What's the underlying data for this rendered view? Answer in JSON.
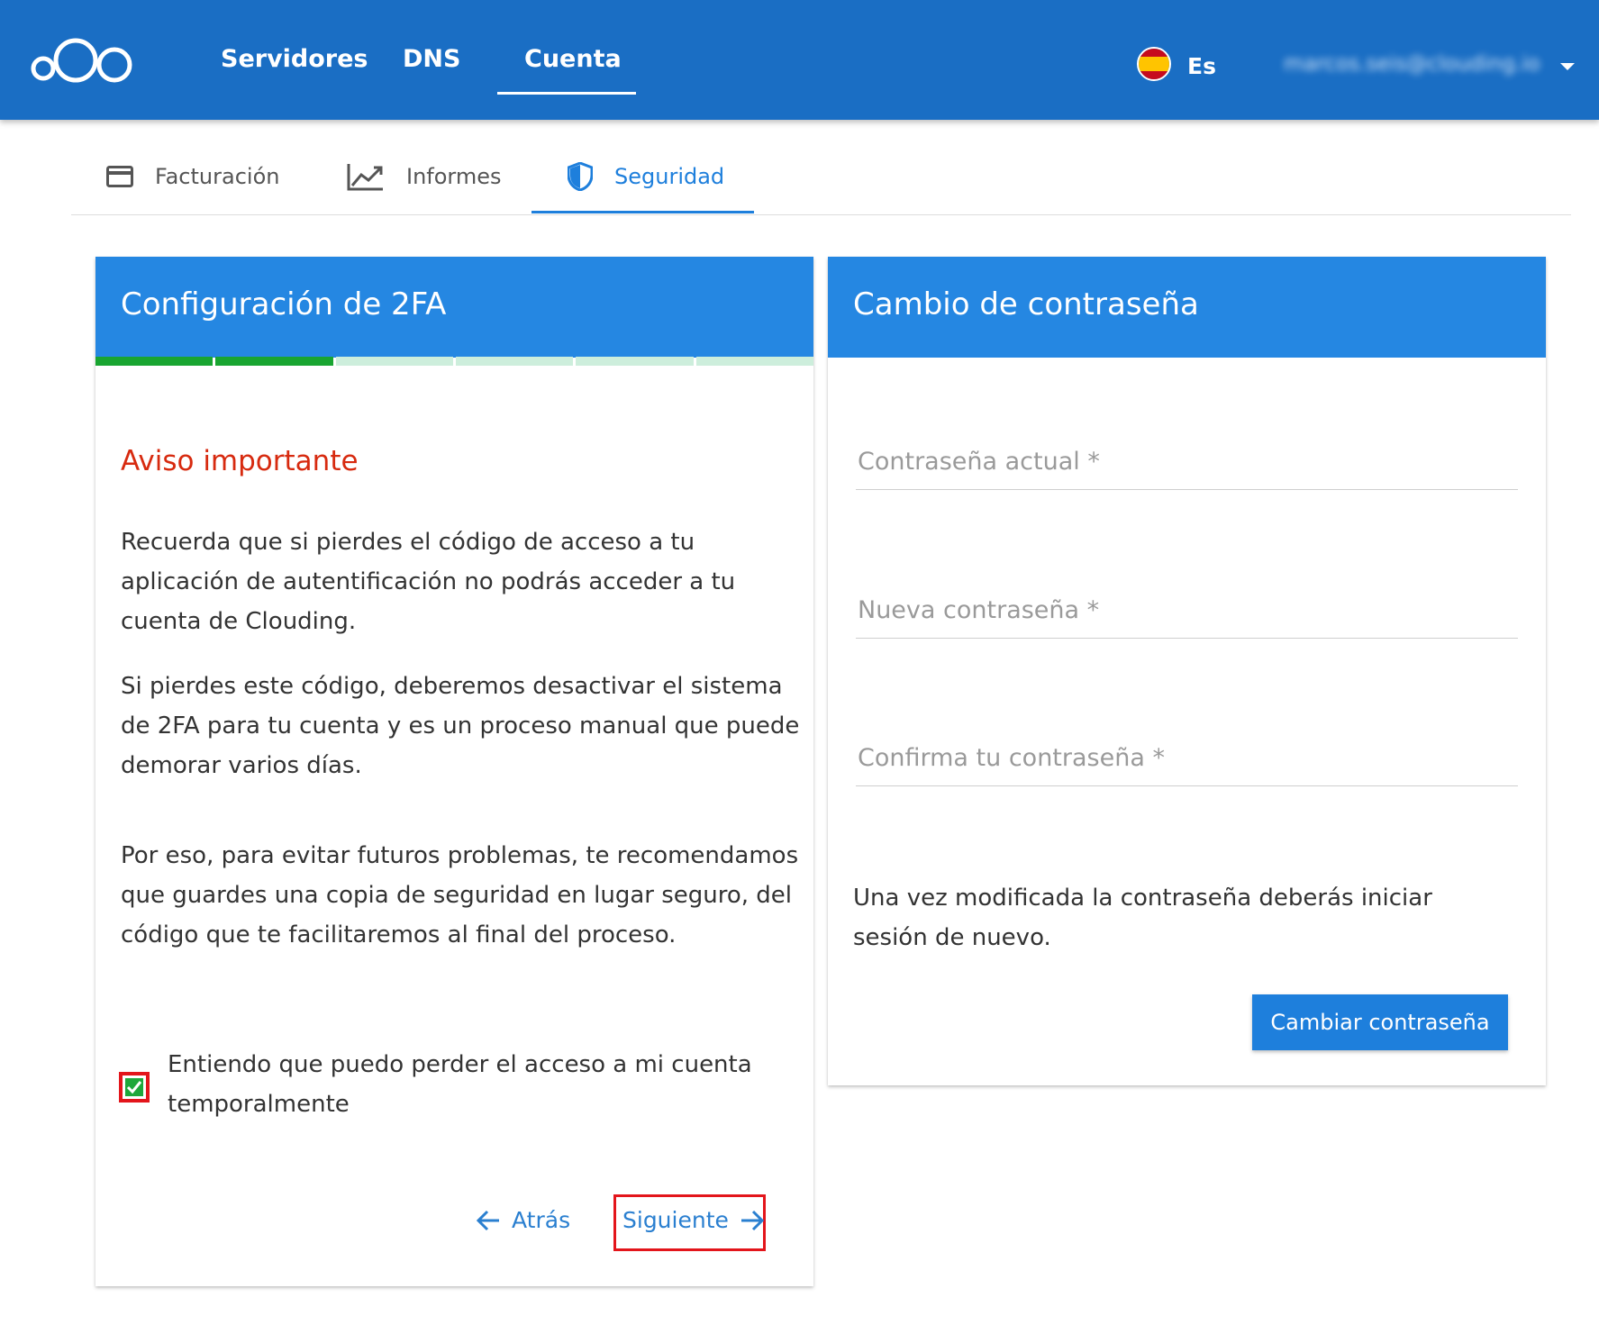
{
  "header": {
    "nav": [
      "Servidores",
      "DNS",
      "Cuenta"
    ],
    "active_nav": "Cuenta",
    "language": "Es",
    "user_email": "marcos.seis@clouding.io"
  },
  "subtabs": [
    {
      "label": "Facturación",
      "icon": "credit-card-icon"
    },
    {
      "label": "Informes",
      "icon": "chart-line-icon"
    },
    {
      "label": "Seguridad",
      "icon": "shield-icon",
      "active": true
    }
  ],
  "twofa": {
    "title": "Configuración de 2FA",
    "steps_total": 6,
    "steps_done": 2,
    "warning_title": "Aviso importante",
    "para1": "Recuerda que si pierdes el código de acceso a tu aplicación de autentificación no podrás acceder a tu cuenta de Clouding.",
    "para2": "Si pierdes este código, deberemos desactivar el sistema de 2FA para tu cuenta y es un proceso manual que puede demorar varios días.",
    "para3": "Por eso, para evitar futuros problemas, te recomendamos que guardes una copia de seguridad en lugar seguro, del código que te facilitaremos al final del proceso.",
    "checkbox_label": "Entiendo que puedo perder el acceso a mi cuenta temporalmente",
    "checkbox_checked": true,
    "back_label": "Atrás",
    "next_label": "Siguiente"
  },
  "password": {
    "title": "Cambio de contraseña",
    "current_label": "Contraseña actual *",
    "new_label": "Nueva contraseña *",
    "confirm_label": "Confirma tu contraseña *",
    "note": "Una vez modificada la contraseña deberás iniciar sesión de nuevo.",
    "submit_label": "Cambiar contraseña"
  },
  "colors": {
    "topbar": "#1a6ec4",
    "card_header": "#2587e2",
    "accent": "#1e7fdc",
    "warning": "#d72a0f",
    "step_done": "#19a531",
    "step_todo": "#cdeedc",
    "highlight": "#e3151b"
  }
}
